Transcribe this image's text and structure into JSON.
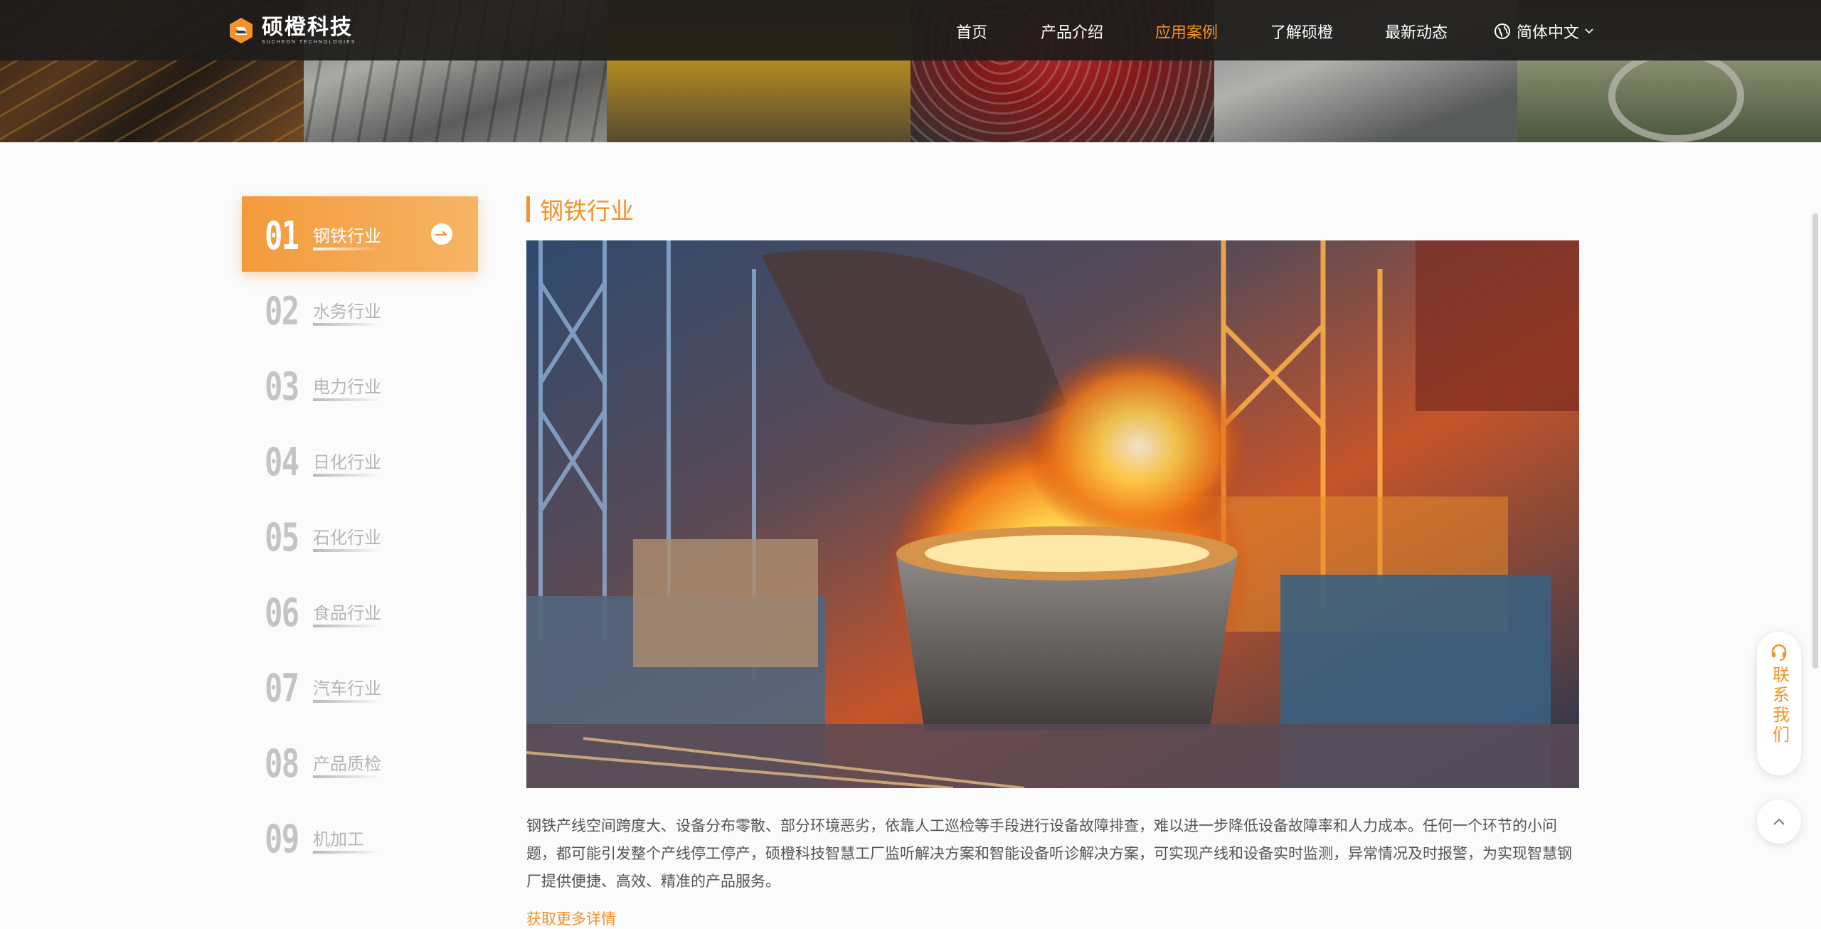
{
  "brand": {
    "name_cn": "硕橙科技",
    "name_en": "SUCHEON TECHNOLOGIES",
    "accent": "#f3922a"
  },
  "nav": [
    {
      "label": "首页",
      "active": false
    },
    {
      "label": "产品介绍",
      "active": false
    },
    {
      "label": "应用案例",
      "active": true
    },
    {
      "label": "了解硕橙",
      "active": false
    },
    {
      "label": "最新动态",
      "active": false
    }
  ],
  "lang": {
    "label": "简体中文",
    "icon": "globe-icon"
  },
  "sidebar": {
    "items": [
      {
        "num": "01",
        "label": "钢铁行业",
        "active": true
      },
      {
        "num": "02",
        "label": "水务行业",
        "active": false
      },
      {
        "num": "03",
        "label": "电力行业",
        "active": false
      },
      {
        "num": "04",
        "label": "日化行业",
        "active": false
      },
      {
        "num": "05",
        "label": "石化行业",
        "active": false
      },
      {
        "num": "06",
        "label": "食品行业",
        "active": false
      },
      {
        "num": "07",
        "label": "汽车行业",
        "active": false
      },
      {
        "num": "08",
        "label": "产品质检",
        "active": false
      },
      {
        "num": "09",
        "label": "机加工",
        "active": false
      }
    ]
  },
  "main": {
    "title": "钢铁行业",
    "description": "钢铁产线空间跨度大、设备分布零散、部分环境恶劣，依靠人工巡检等手段进行设备故障排查，难以进一步降低设备故障率和人力成本。任何一个环节的小问题，都可能引发整个产线停工停产，硕橙科技智慧工厂监听解决方案和智能设备听诊解决方案，可实现产线和设备实时监测，异常情况及时报警，为实现智慧钢厂提供便捷、高效、精准的产品服务。",
    "more_link": "获取更多详情"
  },
  "float": {
    "contact_label": "联系我们",
    "contact_icon": "headset-icon",
    "top_icon": "chevron-up-icon"
  }
}
